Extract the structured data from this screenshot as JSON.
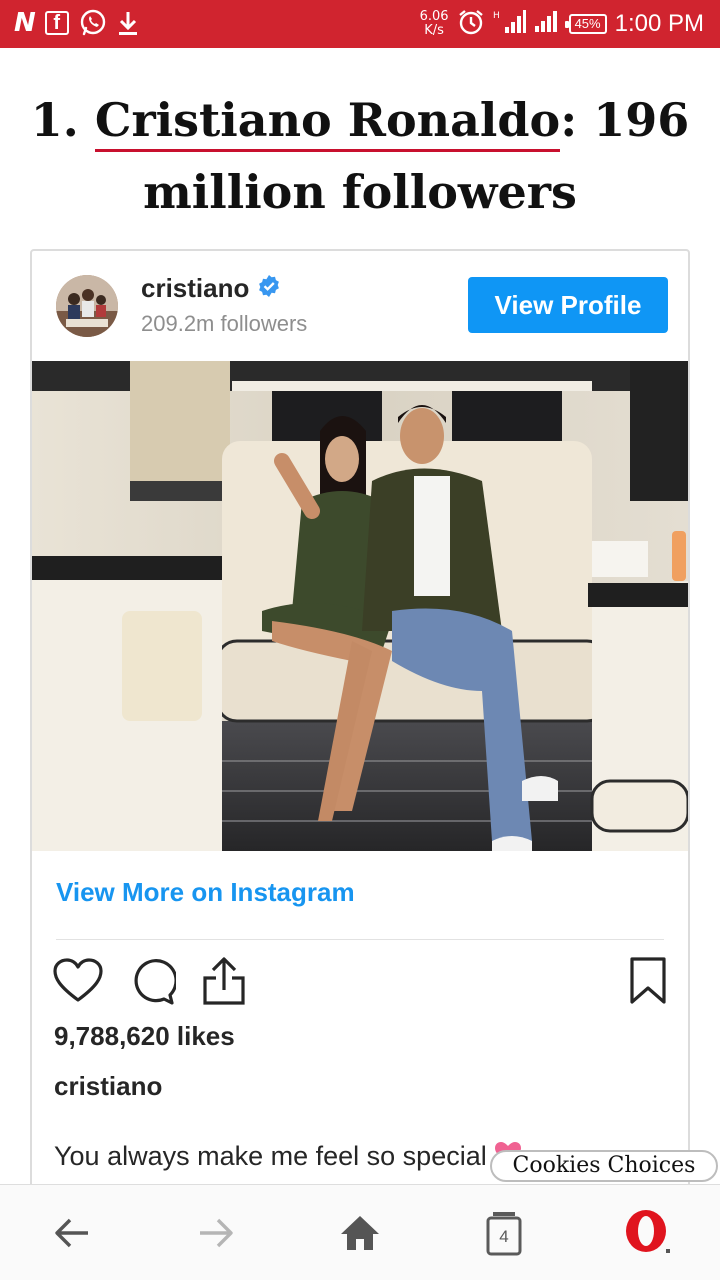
{
  "status_bar": {
    "left_icons": [
      "n-news-icon",
      "facebook-icon",
      "whatsapp-icon",
      "download-icon"
    ],
    "n_glyph": "N",
    "f_glyph": "f",
    "speed_value": "6.06",
    "speed_unit": "K/s",
    "battery": "45%",
    "time": "1:00 PM"
  },
  "article": {
    "rank": "1.",
    "name": "Cristiano Ronaldo",
    "rest_line1": ": 196",
    "rest_line2": "million followers"
  },
  "instagram_embed": {
    "username": "cristiano",
    "followers": "209.2m followers",
    "view_profile_label": "View Profile",
    "view_more_label": "View More on Instagram",
    "likes": "9,788,620 likes",
    "owner": "cristiano",
    "caption": "You always make me feel so special"
  },
  "cookies_label": "Cookies Choices",
  "bottom_nav": {
    "tab_count": "4"
  },
  "colors": {
    "status_bar": "#d0242f",
    "instagram_blue": "#0f96f5",
    "link_blue": "#1795f0",
    "opera_red": "#e0141e"
  }
}
